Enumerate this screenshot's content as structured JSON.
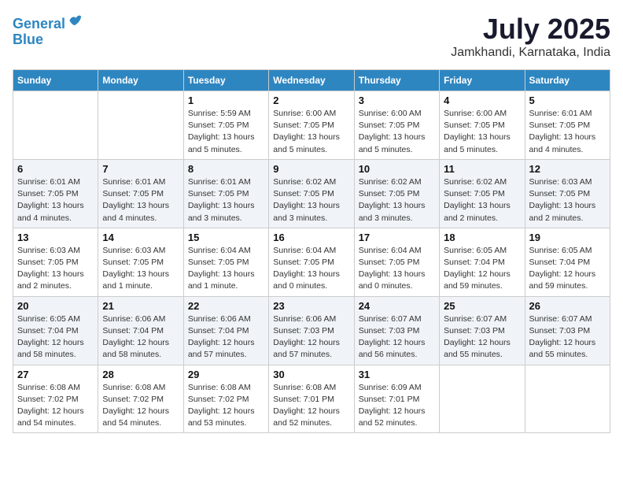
{
  "header": {
    "logo_line1": "General",
    "logo_line2": "Blue",
    "month_year": "July 2025",
    "location": "Jamkhandi, Karnataka, India"
  },
  "weekdays": [
    "Sunday",
    "Monday",
    "Tuesday",
    "Wednesday",
    "Thursday",
    "Friday",
    "Saturday"
  ],
  "weeks": [
    [
      {
        "day": "",
        "info": ""
      },
      {
        "day": "",
        "info": ""
      },
      {
        "day": "1",
        "info": "Sunrise: 5:59 AM\nSunset: 7:05 PM\nDaylight: 13 hours and 5 minutes."
      },
      {
        "day": "2",
        "info": "Sunrise: 6:00 AM\nSunset: 7:05 PM\nDaylight: 13 hours and 5 minutes."
      },
      {
        "day": "3",
        "info": "Sunrise: 6:00 AM\nSunset: 7:05 PM\nDaylight: 13 hours and 5 minutes."
      },
      {
        "day": "4",
        "info": "Sunrise: 6:00 AM\nSunset: 7:05 PM\nDaylight: 13 hours and 5 minutes."
      },
      {
        "day": "5",
        "info": "Sunrise: 6:01 AM\nSunset: 7:05 PM\nDaylight: 13 hours and 4 minutes."
      }
    ],
    [
      {
        "day": "6",
        "info": "Sunrise: 6:01 AM\nSunset: 7:05 PM\nDaylight: 13 hours and 4 minutes."
      },
      {
        "day": "7",
        "info": "Sunrise: 6:01 AM\nSunset: 7:05 PM\nDaylight: 13 hours and 4 minutes."
      },
      {
        "day": "8",
        "info": "Sunrise: 6:01 AM\nSunset: 7:05 PM\nDaylight: 13 hours and 3 minutes."
      },
      {
        "day": "9",
        "info": "Sunrise: 6:02 AM\nSunset: 7:05 PM\nDaylight: 13 hours and 3 minutes."
      },
      {
        "day": "10",
        "info": "Sunrise: 6:02 AM\nSunset: 7:05 PM\nDaylight: 13 hours and 3 minutes."
      },
      {
        "day": "11",
        "info": "Sunrise: 6:02 AM\nSunset: 7:05 PM\nDaylight: 13 hours and 2 minutes."
      },
      {
        "day": "12",
        "info": "Sunrise: 6:03 AM\nSunset: 7:05 PM\nDaylight: 13 hours and 2 minutes."
      }
    ],
    [
      {
        "day": "13",
        "info": "Sunrise: 6:03 AM\nSunset: 7:05 PM\nDaylight: 13 hours and 2 minutes."
      },
      {
        "day": "14",
        "info": "Sunrise: 6:03 AM\nSunset: 7:05 PM\nDaylight: 13 hours and 1 minute."
      },
      {
        "day": "15",
        "info": "Sunrise: 6:04 AM\nSunset: 7:05 PM\nDaylight: 13 hours and 1 minute."
      },
      {
        "day": "16",
        "info": "Sunrise: 6:04 AM\nSunset: 7:05 PM\nDaylight: 13 hours and 0 minutes."
      },
      {
        "day": "17",
        "info": "Sunrise: 6:04 AM\nSunset: 7:05 PM\nDaylight: 13 hours and 0 minutes."
      },
      {
        "day": "18",
        "info": "Sunrise: 6:05 AM\nSunset: 7:04 PM\nDaylight: 12 hours and 59 minutes."
      },
      {
        "day": "19",
        "info": "Sunrise: 6:05 AM\nSunset: 7:04 PM\nDaylight: 12 hours and 59 minutes."
      }
    ],
    [
      {
        "day": "20",
        "info": "Sunrise: 6:05 AM\nSunset: 7:04 PM\nDaylight: 12 hours and 58 minutes."
      },
      {
        "day": "21",
        "info": "Sunrise: 6:06 AM\nSunset: 7:04 PM\nDaylight: 12 hours and 58 minutes."
      },
      {
        "day": "22",
        "info": "Sunrise: 6:06 AM\nSunset: 7:04 PM\nDaylight: 12 hours and 57 minutes."
      },
      {
        "day": "23",
        "info": "Sunrise: 6:06 AM\nSunset: 7:03 PM\nDaylight: 12 hours and 57 minutes."
      },
      {
        "day": "24",
        "info": "Sunrise: 6:07 AM\nSunset: 7:03 PM\nDaylight: 12 hours and 56 minutes."
      },
      {
        "day": "25",
        "info": "Sunrise: 6:07 AM\nSunset: 7:03 PM\nDaylight: 12 hours and 55 minutes."
      },
      {
        "day": "26",
        "info": "Sunrise: 6:07 AM\nSunset: 7:03 PM\nDaylight: 12 hours and 55 minutes."
      }
    ],
    [
      {
        "day": "27",
        "info": "Sunrise: 6:08 AM\nSunset: 7:02 PM\nDaylight: 12 hours and 54 minutes."
      },
      {
        "day": "28",
        "info": "Sunrise: 6:08 AM\nSunset: 7:02 PM\nDaylight: 12 hours and 54 minutes."
      },
      {
        "day": "29",
        "info": "Sunrise: 6:08 AM\nSunset: 7:02 PM\nDaylight: 12 hours and 53 minutes."
      },
      {
        "day": "30",
        "info": "Sunrise: 6:08 AM\nSunset: 7:01 PM\nDaylight: 12 hours and 52 minutes."
      },
      {
        "day": "31",
        "info": "Sunrise: 6:09 AM\nSunset: 7:01 PM\nDaylight: 12 hours and 52 minutes."
      },
      {
        "day": "",
        "info": ""
      },
      {
        "day": "",
        "info": ""
      }
    ]
  ]
}
